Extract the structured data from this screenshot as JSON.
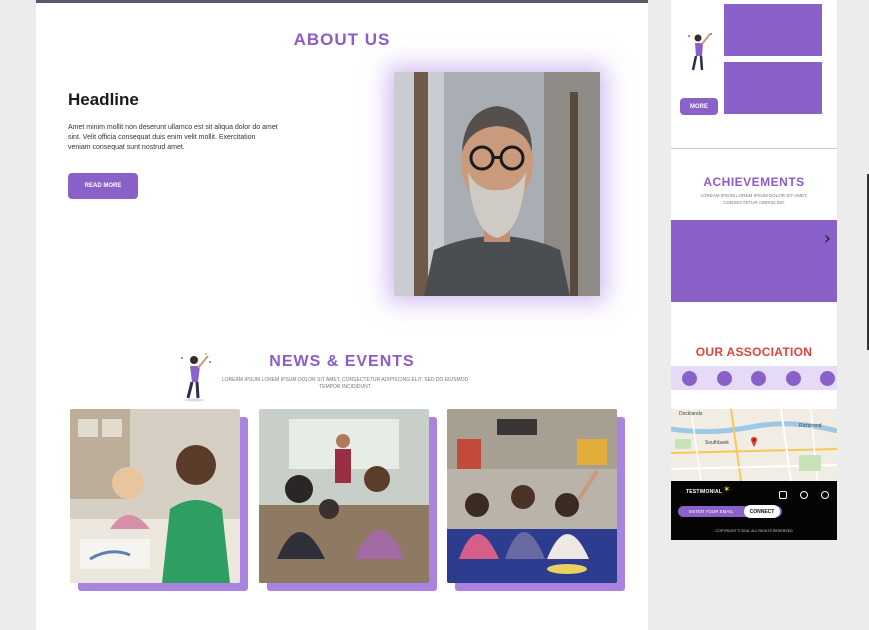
{
  "about": {
    "title": "ABOUT US",
    "headline": "Headline",
    "body": "Amet minim mollit non deserunt ullamco est sit aliqua dolor do amet sint. Velit officia consequat duis enim velit mollit. Exercitation veniam consequat sunt nostrud amet.",
    "button": "READ MORE"
  },
  "news": {
    "title": "NEWS & EVENTS",
    "subtitle": "LOREAM IPSUM LOREM IPSUM DOLOR SIT AMET, CONSECTETUR ADIPISCING ELIT, SED DO EIUSMOD TEMPOR INCIDIDUNT"
  },
  "sidebar": {
    "more_button": "MORE",
    "achievements": {
      "title": "ACHIEVEMENTS",
      "subtitle": "LOREAM IPSUM LOREM IPSUM DOLOR SIT AMET, CONSECTETUR ADIPISCING"
    },
    "association": {
      "title": "OUR ASSOCIATION"
    },
    "map": {
      "labels": [
        "Docklands",
        "Richmond",
        "Southbank"
      ]
    },
    "footer": {
      "testimonial": "TESTIMONIAL",
      "email_placeholder": "ENTER YOUR EMAIL",
      "connect": "CONNECT",
      "copyright": "COPYRIGHT © 2016. ALL RIGHTS RESERVED",
      "social_icons": [
        "instagram-icon",
        "pinterest-icon",
        "whatsapp-icon"
      ]
    }
  },
  "colors": {
    "accent": "#8a60c9",
    "accent_light": "#a884e0",
    "association_red": "#e0423c",
    "footer_bg": "#050505"
  }
}
